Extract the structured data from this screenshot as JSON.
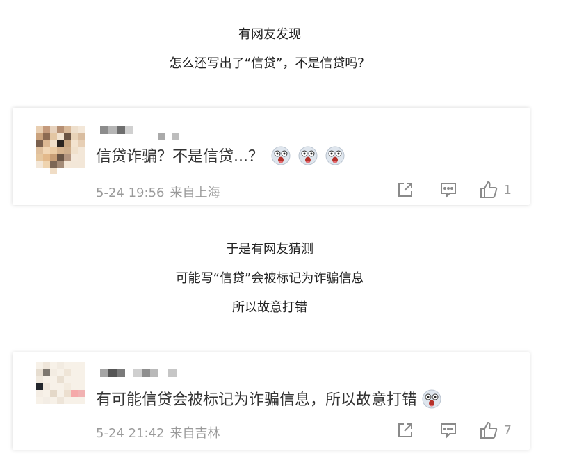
{
  "captions_top": [
    "有网友发现",
    "怎么还写出了“信贷”，不是信贷吗？"
  ],
  "captions_mid": [
    "于是有网友猜测",
    "可能写“信贷”会被标记为诈骗信息",
    "所以故意打错"
  ],
  "comments": [
    {
      "text": "信贷诈骗？不是信贷...？",
      "emoji_count": 3,
      "date": "5-24 19:56",
      "location": "来自上海",
      "likes": "1"
    },
    {
      "text": "有可能信贷会被标记为诈骗信息，所以故意打错",
      "emoji_count": 1,
      "date": "5-24 21:42",
      "location": "来自吉林",
      "likes": "7"
    }
  ],
  "icons": {
    "share": "share-icon",
    "comment": "comment-icon",
    "like": "thumbs-up-icon",
    "emoji": "surprised-emoji-icon"
  },
  "colors": {
    "meta": "#9a9a9a",
    "text": "#333333"
  }
}
